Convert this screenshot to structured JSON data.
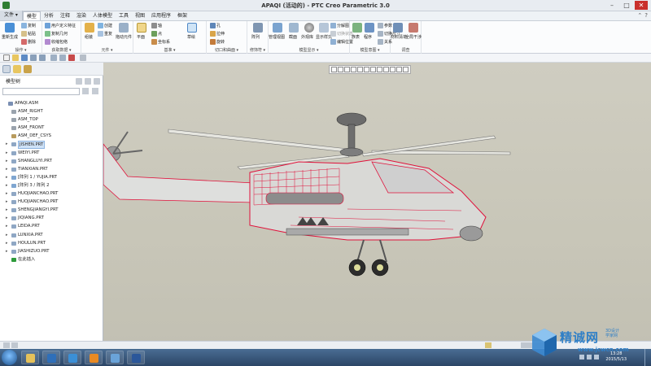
{
  "window": {
    "title": "APAQI (活动的) - PTC Creo Parametric 3.0"
  },
  "ribbon_tabs": {
    "file": "文件 ▾",
    "items": [
      "模型",
      "分析",
      "注释",
      "渲染",
      "人体模型",
      "工具",
      "视图",
      "应用程序",
      "框架"
    ],
    "active_index": 0
  },
  "ribbon": {
    "groups": {
      "operations": "操作 ▾",
      "get_data": "获取数据 ▾",
      "component": "元件 ▾",
      "datum": "基准 ▾",
      "cut_surface": "切口和曲面 ▾",
      "modifiers": "修饰符 ▾",
      "model_display": "模型显示 ▾",
      "model_intent": "模型意图 ▾",
      "investigate": "调查"
    },
    "buttons": {
      "regenerate": "重新生成",
      "copy": "复制",
      "paste": "粘贴",
      "delete": "删除",
      "user_defined_feature": "用户定义特征",
      "copy_geometry": "复制几何",
      "shrinkwrap": "收缩包络",
      "assemble": "组装",
      "create": "创建",
      "repeat": "重复",
      "drag_components": "拖动元件",
      "plane": "平面",
      "axis": "轴",
      "point": "点",
      "coordinate_system": "坐标系",
      "sketch": "草绘",
      "hole": "孔",
      "extrude": "拉伸",
      "revolve": "旋转",
      "pattern": "阵列",
      "manage_views": "管理视图",
      "section": "截面",
      "appearance_gallery": "外观库",
      "display_style": "显示样式",
      "explode_view": "分解图",
      "toggle_status": "切换状态",
      "edit_position": "编辑位置",
      "family_table": "族表",
      "parameters": "参数",
      "switch_dimensions": "切换尺寸",
      "relations": "关系",
      "program": "程序",
      "bom": "材料清单",
      "global_interference": "全局干涉",
      "assembly_layout": "元件布局"
    }
  },
  "model_tree": {
    "header": "模型树",
    "items": [
      {
        "label": "APAQI.ASM",
        "expander": "",
        "icon": "assembly-icon",
        "icon_color": "#7a8fb3",
        "indent": 0
      },
      {
        "label": "ASM_RIGHT",
        "expander": "",
        "icon": "datum-plane-icon",
        "icon_color": "#9aa3ad",
        "indent": 1
      },
      {
        "label": "ASM_TOP",
        "expander": "",
        "icon": "datum-plane-icon",
        "icon_color": "#9aa3ad",
        "indent": 1
      },
      {
        "label": "ASM_FRONT",
        "expander": "",
        "icon": "datum-plane-icon",
        "icon_color": "#9aa3ad",
        "indent": 1
      },
      {
        "label": "ASM_DEF_CSYS",
        "expander": "",
        "icon": "csys-icon",
        "icon_color": "#b89b5e",
        "indent": 1
      },
      {
        "label": "JISHEN.PRT",
        "expander": "▸",
        "icon": "part-icon",
        "icon_color": "#8fa7c4",
        "indent": 1,
        "selected": true
      },
      {
        "label": "WEIYI.PRT",
        "expander": "▸",
        "icon": "part-icon",
        "icon_color": "#8fa7c4",
        "indent": 1
      },
      {
        "label": "SHANGLUYI.PRT",
        "expander": "▸",
        "icon": "part-icon",
        "icon_color": "#8fa7c4",
        "indent": 1
      },
      {
        "label": "TIANXIAN.PRT",
        "expander": "▸",
        "icon": "part-icon",
        "icon_color": "#8fa7c4",
        "indent": 1
      },
      {
        "label": "[阵列 1 / YUJIA.PRT",
        "expander": "▸",
        "icon": "pattern-icon",
        "icon_color": "#7fa6d1",
        "indent": 1
      },
      {
        "label": "[阵列 3 / 阵列 2",
        "expander": "▸",
        "icon": "pattern-icon",
        "icon_color": "#7fa6d1",
        "indent": 1
      },
      {
        "label": "HUOJIANCHAO.PRT",
        "expander": "▸",
        "icon": "part-icon",
        "icon_color": "#8fa7c4",
        "indent": 1
      },
      {
        "label": "HUOJIANCHAO.PRT",
        "expander": "▸",
        "icon": "part-icon",
        "icon_color": "#8fa7c4",
        "indent": 1
      },
      {
        "label": "SHENGJIANGYI.PRT",
        "expander": "▸",
        "icon": "part-icon",
        "icon_color": "#8fa7c4",
        "indent": 1
      },
      {
        "label": "JIQIANG.PRT",
        "expander": "▸",
        "icon": "part-icon",
        "icon_color": "#8fa7c4",
        "indent": 1
      },
      {
        "label": "LEIDA.PRT",
        "expander": "▸",
        "icon": "part-icon",
        "icon_color": "#8fa7c4",
        "indent": 1
      },
      {
        "label": "LUNXIA.PRT",
        "expander": "▸",
        "icon": "part-icon",
        "icon_color": "#8fa7c4",
        "indent": 1
      },
      {
        "label": "HOULUN.PRT",
        "expander": "▸",
        "icon": "part-icon",
        "icon_color": "#8fa7c4",
        "indent": 1
      },
      {
        "label": "JIASHIZUO.PRT",
        "expander": "▸",
        "icon": "part-icon",
        "icon_color": "#8fa7c4",
        "indent": 1
      },
      {
        "label": "在此插入",
        "expander": "",
        "icon": "insert-here-icon",
        "icon_color": "#2e9b3b",
        "indent": 1
      }
    ]
  },
  "taskbar": {
    "clock_time": "13:28",
    "clock_date": "2015/5/13"
  },
  "watermark": {
    "text": "精诚网",
    "sub1": "3D设计",
    "sub2": "学家网",
    "url": "www.jcwcn.com"
  },
  "colors": {
    "accent": "#2b579a",
    "highlight_edges": "#e0103a",
    "viewport_bg": "#cbc9bc"
  }
}
